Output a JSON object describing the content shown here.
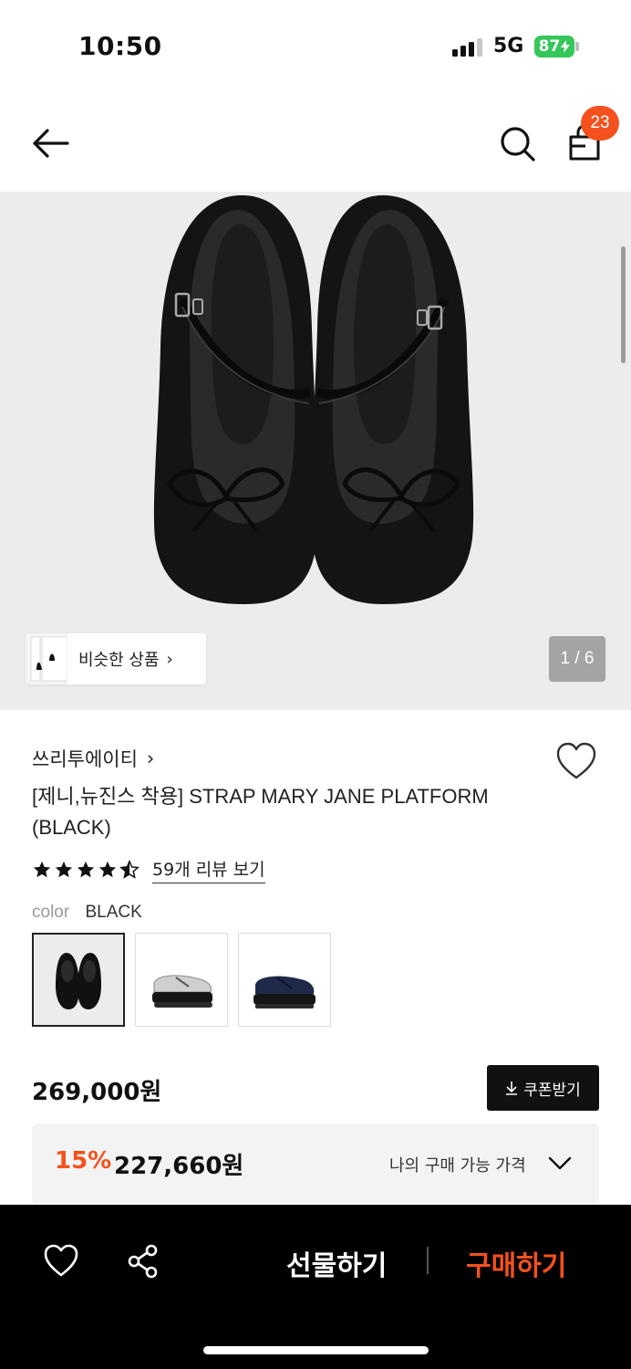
{
  "status_bar": {
    "time": "10:50",
    "network": "5G",
    "battery": "87"
  },
  "header": {
    "cart_count": "23",
    "icons": [
      "back-arrow-icon",
      "search-icon",
      "shopping-bag-icon"
    ]
  },
  "gallery": {
    "similar_label": "비슷한 상품",
    "similar_chevron": "›",
    "pager": "1 / 6"
  },
  "product": {
    "brand": "쓰리투에이티",
    "brand_chevron": "›",
    "title": "[제니,뉴진스 착용] STRAP MARY JANE PLATFORM (BLACK)",
    "rating": 4.5,
    "reviews_link": "59개 리뷰 보기",
    "color_label": "color",
    "color_value": "BLACK",
    "color_options": [
      "black",
      "silver",
      "navy"
    ]
  },
  "price": {
    "original": "269,000원",
    "coupon_label": "쿠폰받기",
    "discount_rate": "15%",
    "discount_price": "227,660원",
    "my_price_label": "나의 구매 가능 가격"
  },
  "bottom_bar": {
    "gift_label": "선물하기",
    "buy_label": "구매하기"
  },
  "colors": {
    "accent": "#f4511e",
    "battery": "#34c759"
  }
}
